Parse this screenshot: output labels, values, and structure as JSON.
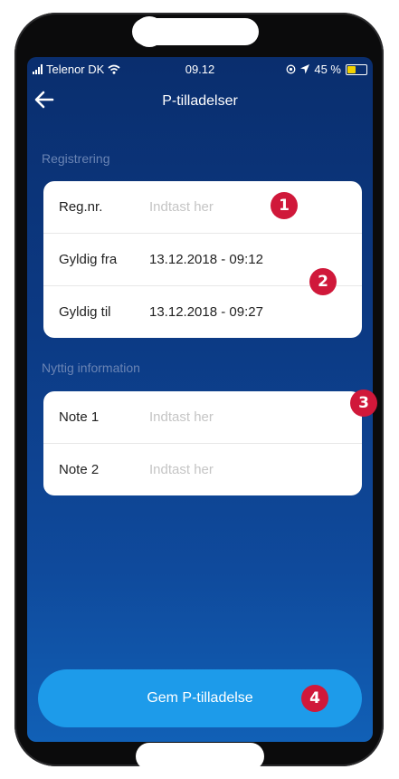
{
  "status_bar": {
    "carrier": "Telenor DK",
    "time": "09.12",
    "battery": "45 %"
  },
  "header": {
    "title": "P-tilladelser"
  },
  "sections": {
    "registration": "Registrering",
    "info": "Nyttig information"
  },
  "registration": [
    {
      "label": "Reg.nr.",
      "value": "",
      "placeholder": "Indtast her"
    },
    {
      "label": "Gyldig fra",
      "value": "13.12.2018 - 09:12",
      "placeholder": ""
    },
    {
      "label": "Gyldig til",
      "value": "13.12.2018 - 09:27",
      "placeholder": ""
    }
  ],
  "info": [
    {
      "label": "Note 1",
      "placeholder": "Indtast her"
    },
    {
      "label": "Note 2",
      "placeholder": "Indtast her"
    }
  ],
  "save_button": "Gem P-tilladelse",
  "badges": [
    "1",
    "2",
    "3",
    "4"
  ],
  "colors": {
    "badge": "#d0183a",
    "button": "#1d9bea",
    "bg_top": "#0a2e6e",
    "bg_bottom": "#1160b6"
  }
}
